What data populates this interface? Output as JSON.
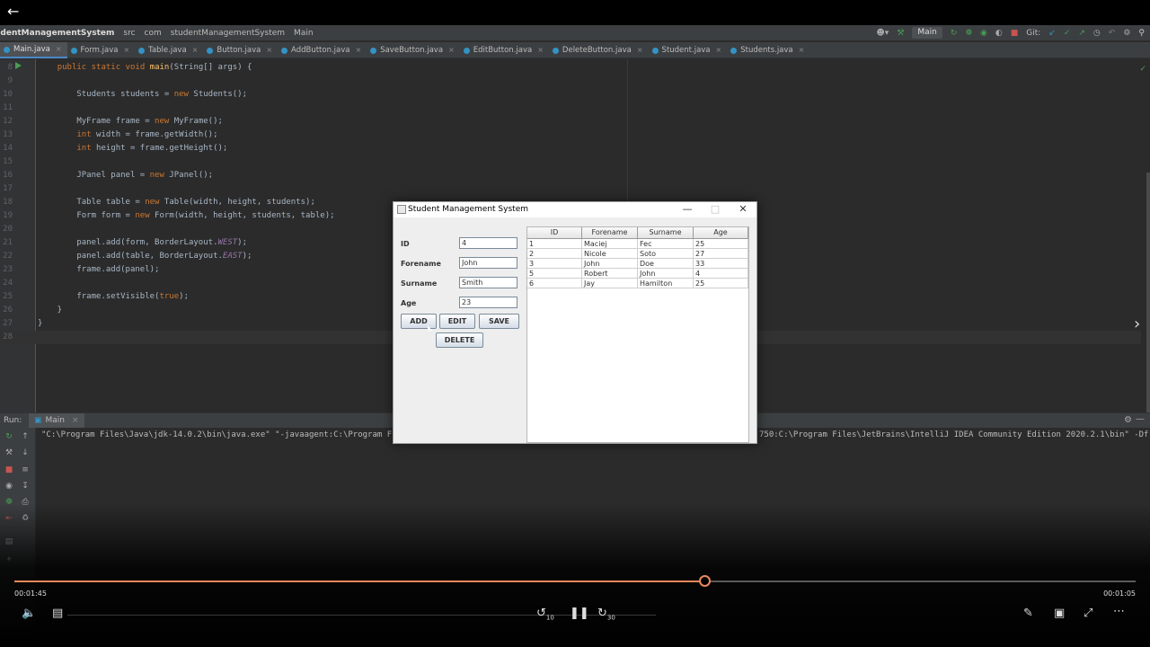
{
  "breadcrumb": {
    "project": "udentManagementSystem",
    "items": [
      "src",
      "com",
      "studentManagementSystem",
      "Main"
    ]
  },
  "toolbar": {
    "run_config": "Main",
    "git_label": "Git:"
  },
  "tabs": [
    "Main.java",
    "Form.java",
    "Table.java",
    "Button.java",
    "AddButton.java",
    "SaveButton.java",
    "EditButton.java",
    "DeleteButton.java",
    "Student.java",
    "Students.java"
  ],
  "code_lines": [
    {
      "n": "8",
      "text": "    public static void main(String[] args) {"
    },
    {
      "n": "9",
      "text": ""
    },
    {
      "n": "10",
      "text": "        Students students = new Students();"
    },
    {
      "n": "11",
      "text": ""
    },
    {
      "n": "12",
      "text": "        MyFrame frame = new MyFrame();"
    },
    {
      "n": "13",
      "text": "        int width = frame.getWidth();"
    },
    {
      "n": "14",
      "text": "        int height = frame.getHeight();"
    },
    {
      "n": "15",
      "text": ""
    },
    {
      "n": "16",
      "text": "        JPanel panel = new JPanel();"
    },
    {
      "n": "17",
      "text": ""
    },
    {
      "n": "18",
      "text": "        Table table = new Table(width, height, students);"
    },
    {
      "n": "19",
      "text": "        Form form = new Form(width, height, students, table);"
    },
    {
      "n": "20",
      "text": ""
    },
    {
      "n": "21",
      "text": "        panel.add(form, BorderLayout.WEST);"
    },
    {
      "n": "22",
      "text": "        panel.add(table, BorderLayout.EAST);"
    },
    {
      "n": "23",
      "text": "        frame.add(panel);"
    },
    {
      "n": "24",
      "text": ""
    },
    {
      "n": "25",
      "text": "        frame.setVisible(true);"
    },
    {
      "n": "26",
      "text": "    }"
    },
    {
      "n": "27",
      "text": "}"
    },
    {
      "n": "28",
      "text": ""
    }
  ],
  "run_panel": {
    "label": "Run:",
    "tab": "Main",
    "console_left": "\"C:\\Program Files\\Java\\jdk-14.0.2\\bin\\java.exe\" \"-javaagent:C:\\Program F",
    "console_right": "750:C:\\Program Files\\JetBrains\\IntelliJ IDEA Community Edition 2020.2.1\\bin\" -Df"
  },
  "app_window": {
    "title": "Student Management System",
    "form": {
      "id_label": "ID",
      "id_value": "4",
      "forename_label": "Forename",
      "forename_value": "John",
      "surname_label": "Surname",
      "surname_value": "Smith",
      "age_label": "Age",
      "age_value": "23"
    },
    "buttons": {
      "add": "ADD",
      "edit": "EDIT",
      "save": "SAVE",
      "delete": "DELETE"
    },
    "table": {
      "columns": [
        "ID",
        "Forename",
        "Surname",
        "Age"
      ],
      "rows": [
        [
          "1",
          "Maciej",
          "Fec",
          "25"
        ],
        [
          "2",
          "Nicole",
          "Soto",
          "27"
        ],
        [
          "3",
          "John",
          "Doe",
          "33"
        ],
        [
          "5",
          "Robert",
          "John",
          "4"
        ],
        [
          "6",
          "Jay",
          "Hamilton",
          "25"
        ]
      ]
    }
  },
  "player": {
    "elapsed": "00:01:45",
    "remaining": "00:01:05",
    "progress_fraction": 0.615,
    "rewind_label": "10",
    "forward_label": "30",
    "accent_color": "#e8895a"
  }
}
